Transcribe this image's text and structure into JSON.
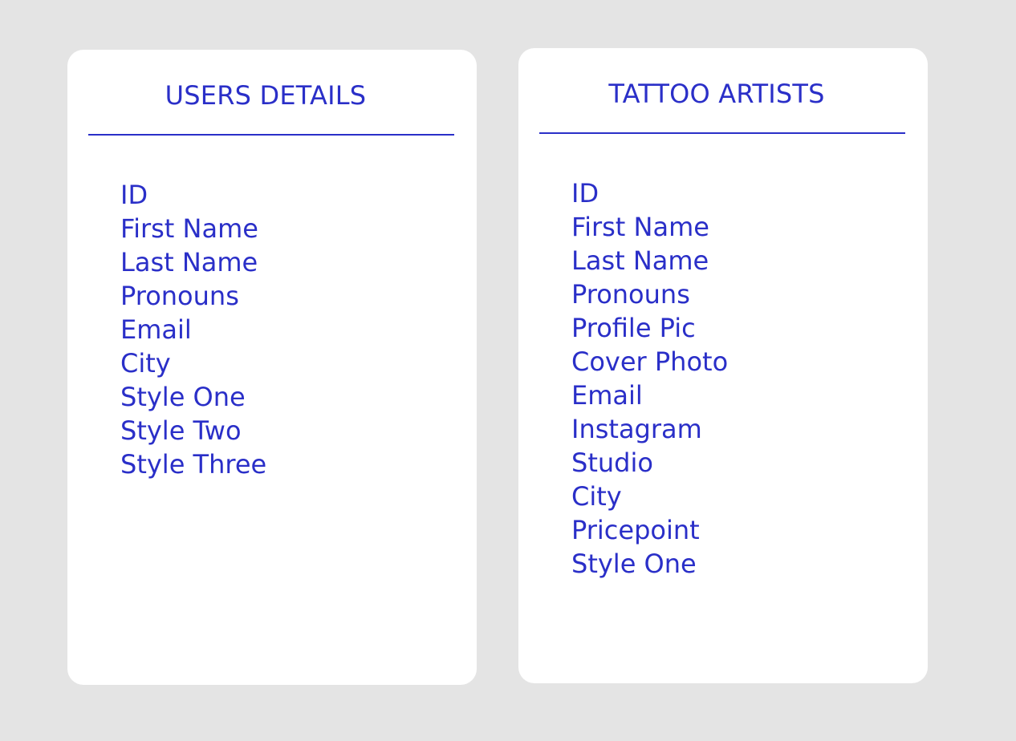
{
  "users_card": {
    "title": "USERS DETAILS",
    "fields": [
      "ID",
      "First Name",
      "Last Name",
      "Pronouns",
      "Email",
      "City",
      "Style One",
      "Style Two",
      "Style Three"
    ]
  },
  "artists_card": {
    "title": "TATTOO ARTISTS",
    "fields": [
      "ID",
      "First Name",
      "Last Name",
      "Pronouns",
      "Profile Pic",
      "Cover Photo",
      "Email",
      "Instagram",
      "Studio",
      "City",
      "Pricepoint",
      "Style One"
    ]
  },
  "colors": {
    "background": "#e4e4e4",
    "card": "#ffffff",
    "accent": "#2a2fc8"
  }
}
